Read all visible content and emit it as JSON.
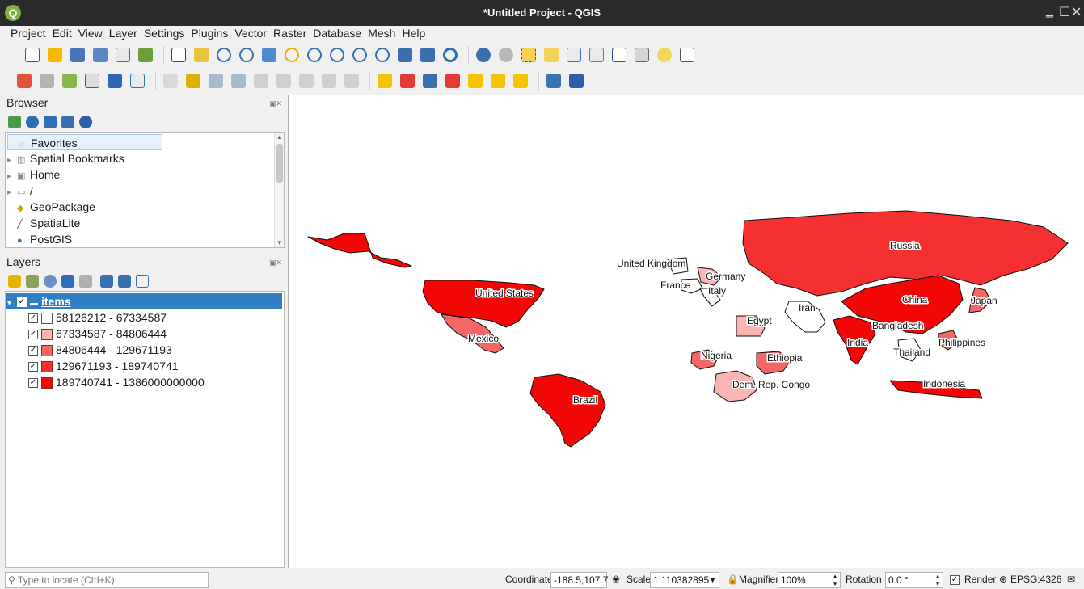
{
  "window": {
    "title": "*Untitled Project - QGIS",
    "app_icon": "qgis-logo",
    "app_icon_letter": "Q",
    "controls": {
      "minimize": "‗",
      "maximize": "☐",
      "close": "✕"
    }
  },
  "menubar": [
    "Project",
    "Edit",
    "View",
    "Layer",
    "Settings",
    "Plugins",
    "Vector",
    "Raster",
    "Database",
    "Mesh",
    "Help"
  ],
  "toolbars": {
    "row1_icons": [
      "new-project-icon",
      "open-project-icon",
      "save-project-icon",
      "save-as-icon",
      "print-layout-icon",
      "style-manager-icon",
      "pan-map-icon",
      "pan-to-selection-icon",
      "zoom-in-icon",
      "zoom-out-icon",
      "zoom-full-icon",
      "zoom-to-selection-icon",
      "zoom-to-layer-icon",
      "zoom-native-icon",
      "zoom-last-icon",
      "zoom-next-icon",
      "new-bookmark-icon",
      "show-bookmarks-icon",
      "refresh-icon",
      "identify-icon",
      "action-icon",
      "select-feature-icon",
      "deselect-icon",
      "attribute-table-icon",
      "field-calculator-icon",
      "statistics-icon",
      "measure-icon",
      "map-tips-icon",
      "text-annotation-icon"
    ],
    "row2_icons": [
      "data-source-manager-icon",
      "new-geopackage-layer-icon",
      "digitize-icon",
      "edit-pencil-icon",
      "toggle-editing-icon",
      "save-edits-icon",
      "vertex-tool-icon",
      "delete-selected-icon",
      "cut-features-icon",
      "copy-features-icon",
      "paste-features-icon",
      "undo-icon",
      "redo-icon",
      "label-toolbar-icon",
      "layer-diagram-icon",
      "highlight-pinned-icon",
      "label-icon",
      "pin-label-icon",
      "show-label-icon",
      "move-label-icon",
      "rotate-label-icon",
      "change-label-icon",
      "python-console-icon",
      "help-icon"
    ]
  },
  "browser": {
    "title": "Browser",
    "tools": [
      "add-selected-icon",
      "refresh-icon",
      "filter-icon",
      "collapse-all-icon",
      "info-icon"
    ],
    "items": [
      {
        "label": "Favorites",
        "icon": "star-icon",
        "glyph": "☆",
        "expandable": false,
        "selected": true
      },
      {
        "label": "Spatial Bookmarks",
        "icon": "bookmark-icon",
        "glyph": "▥",
        "expandable": true
      },
      {
        "label": "Home",
        "icon": "home-folder-icon",
        "glyph": "▣",
        "expandable": true
      },
      {
        "label": "/",
        "icon": "folder-icon",
        "glyph": "▭",
        "expandable": true
      },
      {
        "label": "GeoPackage",
        "icon": "geopackage-icon",
        "glyph": "◆",
        "expandable": false
      },
      {
        "label": "SpatiaLite",
        "icon": "spatialite-icon",
        "glyph": "╱",
        "expandable": false
      },
      {
        "label": "PostGIS",
        "icon": "postgis-icon",
        "glyph": "●",
        "expandable": false
      }
    ]
  },
  "layers": {
    "title": "Layers",
    "tools": [
      "style-layer-icon",
      "add-group-icon",
      "manage-map-themes-icon",
      "filter-legend-icon",
      "expression-filter-icon",
      "expand-all-icon",
      "collapse-all-icon",
      "remove-layer-icon"
    ],
    "layer": {
      "name": "items",
      "checked": true
    },
    "legend": [
      {
        "label": "58126212 - 67334587",
        "color": "#ffffff",
        "checked": true
      },
      {
        "label": "67334587 - 84806444",
        "color": "#fbb4b4",
        "checked": true
      },
      {
        "label": "84806444 - 129671193",
        "color": "#f56767",
        "checked": true
      },
      {
        "label": "129671193 - 189740741",
        "color": "#f43030",
        "checked": true
      },
      {
        "label": "189740741 - 1386000000000",
        "color": "#f20707",
        "checked": true
      }
    ]
  },
  "map_labels": [
    "Russia",
    "United Kingdom",
    "Germany",
    "France",
    "Italy",
    "Iran",
    "China",
    "Japan",
    "United States",
    "Egypt",
    "Bangladesh",
    "Mexico",
    "India",
    "Philippines",
    "Thailand",
    "Nigeria",
    "Ethiopia",
    "Indonesia",
    "Dem. Rep. Congo",
    "Brazil"
  ],
  "statusbar": {
    "locator_placeholder": "Type to locate (Ctrl+K)",
    "coordinate_label": "Coordinate",
    "coordinate_value": "-188.5,107.7",
    "scale_label": "Scale",
    "scale_value": "1:110382895",
    "magnifier_label": "Magnifier",
    "magnifier_value": "100%",
    "rotation_label": "Rotation",
    "rotation_value": "0.0 °",
    "render_label": "Render",
    "render_checked": true,
    "crs": "EPSG:4326"
  }
}
